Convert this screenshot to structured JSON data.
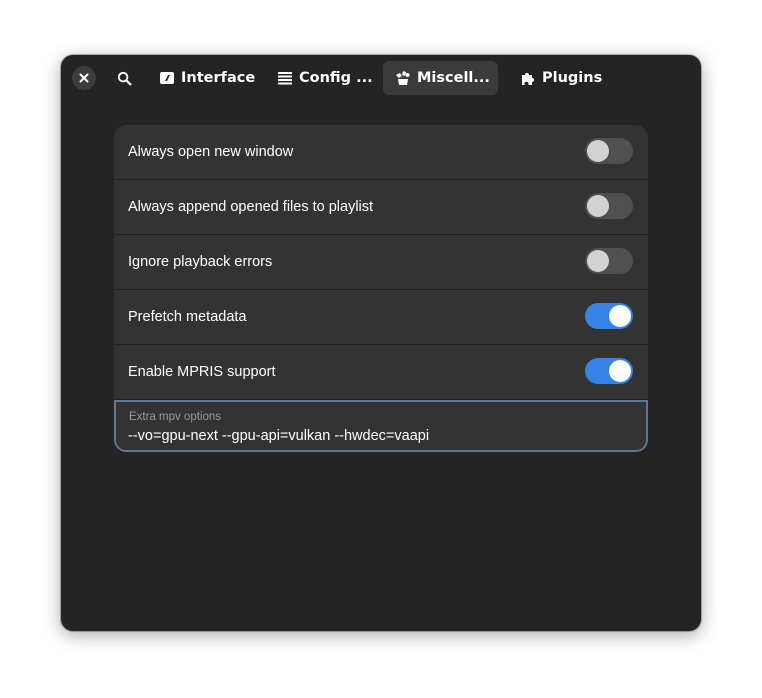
{
  "headerbar": {
    "close_icon": "close-icon",
    "search_icon": "search-icon",
    "tabs": [
      {
        "label": "Interface",
        "icon": "interface-icon",
        "active": false
      },
      {
        "label": "Config ...",
        "icon": "list-icon",
        "active": false
      },
      {
        "label": "Miscell...",
        "icon": "misc-icon",
        "active": true
      },
      {
        "label": "Plugins",
        "icon": "puzzle-icon",
        "active": false
      }
    ]
  },
  "settings": {
    "rows": [
      {
        "label": "Always open new window",
        "enabled": false
      },
      {
        "label": "Always append opened files to playlist",
        "enabled": false
      },
      {
        "label": "Ignore playback errors",
        "enabled": false
      },
      {
        "label": "Prefetch metadata",
        "enabled": true
      },
      {
        "label": "Enable MPRIS support",
        "enabled": true
      }
    ],
    "extra_options": {
      "title": "Extra mpv options",
      "value": "--vo=gpu-next --gpu-api=vulkan --hwdec=vaapi"
    }
  },
  "colors": {
    "accent": "#3584e4",
    "window_bg": "#242424",
    "card_bg": "#333333"
  }
}
